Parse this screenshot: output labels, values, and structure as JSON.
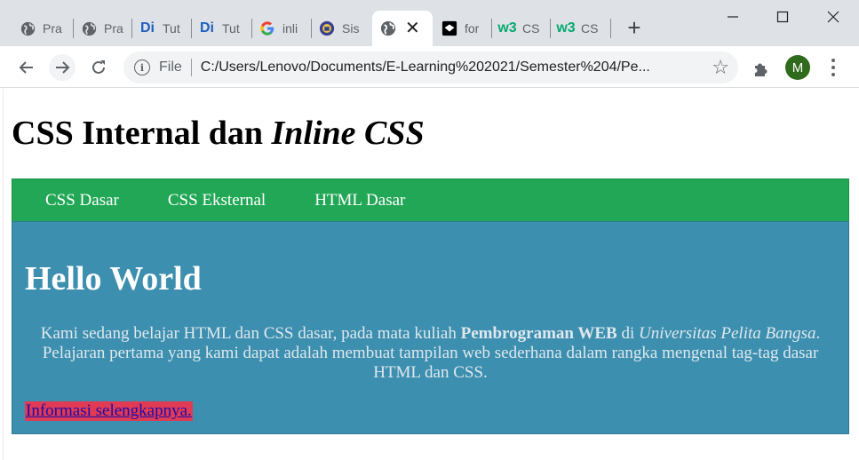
{
  "browser": {
    "tabs": [
      {
        "title": "Pra",
        "favicon": "globe-icon"
      },
      {
        "title": "Pra",
        "favicon": "globe-icon"
      },
      {
        "title": "Tut",
        "favicon": "di-icon"
      },
      {
        "title": "Tut",
        "favicon": "di-icon"
      },
      {
        "title": "inli",
        "favicon": "google-icon"
      },
      {
        "title": "Sis",
        "favicon": "crest-icon"
      },
      {
        "title": "",
        "favicon": "globe-icon",
        "active": true
      },
      {
        "title": "for",
        "favicon": "codepen-icon"
      },
      {
        "title": "CS",
        "favicon": "w3schools-icon"
      },
      {
        "title": "CS",
        "favicon": "w3schools-icon"
      }
    ],
    "favicon_text": {
      "di": "Di",
      "w3": "w3"
    },
    "new_tab_symbol": "+",
    "tab_close_symbol": "✕",
    "window": {
      "minimize": "—",
      "maximize": "☐",
      "close": "✕"
    },
    "address": {
      "scheme": "File",
      "url": "C:/Users/Lenovo/Documents/E-Learning%202021/Semester%204/Pe..."
    },
    "avatar_letter": "M",
    "colors": {
      "tabstrip": "#dee1e6",
      "avatar": "#2e6b1c"
    }
  },
  "page": {
    "heading_plain": "CSS Internal dan ",
    "heading_italic": "Inline CSS",
    "nav": [
      "CSS Dasar",
      "CSS Eksternal",
      "HTML Dasar"
    ],
    "hero": {
      "title": "Hello World",
      "text_1": "Kami sedang belajar HTML dan CSS dasar, pada mata kuliah ",
      "text_bold": "Pembrograman WEB",
      "text_2": " di ",
      "text_italic": "Universitas Pelita Bangsa",
      "text_3": ". Pelajaran pertama yang kami dapat adalah membuat tampilan web sederhana dalam rangka mengenal tag-tag dasar HTML dan CSS.",
      "link": "Informasi selengkapnya."
    },
    "colors": {
      "nav": "#22a756",
      "hero": "#3d8faf",
      "link_bg": "#e03a55",
      "link": "#1a0dab"
    }
  }
}
